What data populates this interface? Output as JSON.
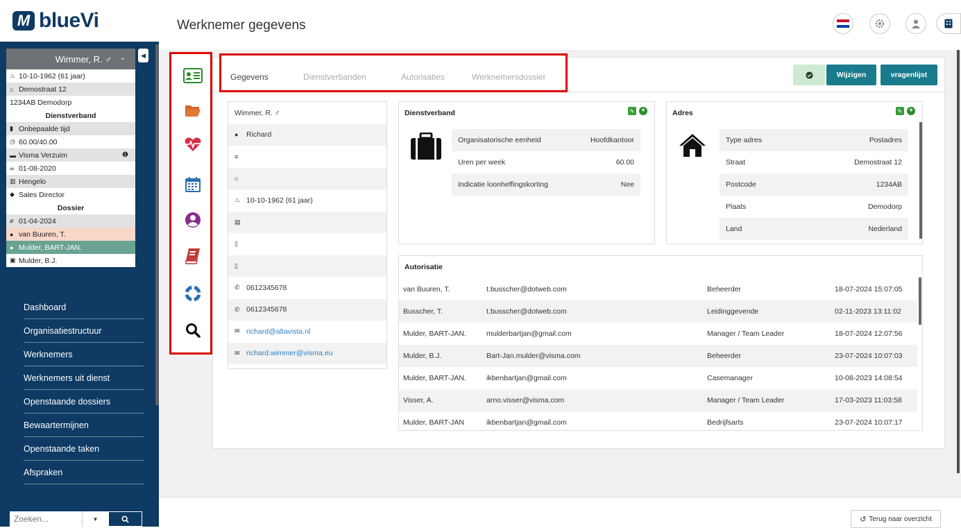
{
  "app": {
    "logo_text": "blueVi"
  },
  "employee": {
    "name": "Wimmer, R. ♂",
    "rows": [
      {
        "icon": "birthday-icon",
        "glyph": "♨",
        "text": "10-10-1962 (61 jaar)"
      },
      {
        "icon": "home-icon",
        "glyph": "⌂",
        "text": "Demostraat 12"
      },
      {
        "icon": "",
        "glyph": "",
        "text": "1234AB Demodorp"
      },
      {
        "section": true,
        "text": "Dienstverband"
      },
      {
        "icon": "briefcase-icon",
        "glyph": "▮",
        "text": "Onbepaalde tijd"
      },
      {
        "icon": "clock-icon",
        "glyph": "◷",
        "text": "60.00/40.00"
      },
      {
        "icon": "ambulance-icon",
        "glyph": "▬",
        "text": "Visma Verzuim",
        "info": true
      },
      {
        "icon": "handshake-icon",
        "glyph": "∞",
        "text": "01-08-2020"
      },
      {
        "icon": "map-icon",
        "glyph": "▥",
        "text": "Hengelo"
      },
      {
        "icon": "tag-icon",
        "glyph": "◆",
        "text": "Sales Director"
      },
      {
        "section": true,
        "text": "Dossier"
      },
      {
        "icon": "thermometer-icon",
        "glyph": "⌀",
        "text": "01-04-2024"
      },
      {
        "icon": "user-icon",
        "glyph": "●",
        "text": "van Buuren, T.",
        "style": "pk"
      },
      {
        "icon": "user-icon",
        "glyph": "●",
        "text": "Mulder, BART-JAN.",
        "style": "tl"
      },
      {
        "icon": "building-icon",
        "glyph": "▣",
        "text": "Mulder, B.J."
      }
    ]
  },
  "nav": [
    "Dashboard",
    "Organisatiestructuur",
    "Werknemers",
    "Werknemers uit dienst",
    "Openstaande dossiers",
    "Bewaartermijnen",
    "Openstaande taken",
    "Afspraken"
  ],
  "search": {
    "placeholder": "Zoeken..."
  },
  "header": {
    "title": "Werknemer gegevens"
  },
  "tabs": [
    "Gegevens",
    "Dienstverbanden",
    "Autorisaties",
    "Werknemersdossier"
  ],
  "buttons": {
    "wijzigen": "Wijzigen",
    "vragenlijst": "vragenlijst"
  },
  "colors": {
    "teal": "#1a7b8c",
    "green_btn": "#cfe9d2",
    "navy": "#0e3a63",
    "accent_red": "#d00000"
  },
  "person": [
    {
      "icon": "",
      "glyph": "",
      "text": "Wimmer, R. ♂"
    },
    {
      "icon": "user-icon",
      "glyph": "●",
      "text": "Richard"
    },
    {
      "icon": "list-icon",
      "glyph": "≡",
      "text": ""
    },
    {
      "icon": "home-icon",
      "glyph": "⌂",
      "text": ""
    },
    {
      "icon": "birthday-icon",
      "glyph": "♨",
      "text": "10-10-1962 (61 jaar)"
    },
    {
      "icon": "id-card-icon",
      "glyph": "▤",
      "text": ""
    },
    {
      "icon": "mobile-icon",
      "glyph": "▯",
      "text": ""
    },
    {
      "icon": "mobile-icon",
      "glyph": "▯",
      "text": ""
    },
    {
      "icon": "phone-icon",
      "glyph": "✆",
      "text": "0612345678"
    },
    {
      "icon": "phone-icon",
      "glyph": "✆",
      "text": "0612345678"
    },
    {
      "icon": "mail-icon",
      "glyph": "✉",
      "text": "richard@altavista.nl",
      "link": true
    },
    {
      "icon": "mail-icon",
      "glyph": "✉",
      "text": "richard.wimmer@visma.eu",
      "link": true
    }
  ],
  "dienstverband": {
    "title": "Dienstverband",
    "rows": [
      {
        "label": "Organisatorische eenheid",
        "value": "Hoofdkantoor"
      },
      {
        "label": "Uren per week",
        "value": "60.00"
      },
      {
        "label": "Indicatie loonheffingskorting",
        "value": "Nee"
      }
    ]
  },
  "adres": {
    "title": "Adres",
    "rows": [
      {
        "label": "Type adres",
        "value": "Postadres"
      },
      {
        "label": "Straat",
        "value": "Demostraat 12"
      },
      {
        "label": "Postcode",
        "value": "1234AB"
      },
      {
        "label": "Plaats",
        "value": "Demodorp"
      },
      {
        "label": "Land",
        "value": "Nederland"
      }
    ]
  },
  "autorisatie": {
    "title": "Autorisatie",
    "rows": [
      {
        "naam": "van Buuren, T.",
        "email": "t.busscher@dotweb.com",
        "rol": "Beheerder",
        "datum": "18-07-2024 15:07:05"
      },
      {
        "naam": "Busscher, T.",
        "email": "t.busscher@dotweb.com",
        "rol": "Leidinggevende",
        "datum": "02-11-2023 13:11:02"
      },
      {
        "naam": "Mulder, BART-JAN.",
        "email": "mulderbartjan@gmail.com",
        "rol": "Manager / Team Leader",
        "datum": "18-07-2024 12:07:56"
      },
      {
        "naam": "Mulder, B.J.",
        "email": "Bart-Jan.mulder@visma.com",
        "rol": "Beheerder",
        "datum": "23-07-2024 10:07:03"
      },
      {
        "naam": "Mulder, BART-JAN.",
        "email": "ikbenbartjan@gmail.com",
        "rol": "Casemanager",
        "datum": "10-08-2023 14:08:54"
      },
      {
        "naam": "Visser, A.",
        "email": "arno.visser@visma.com",
        "rol": "Manager / Team Leader",
        "datum": "17-03-2023 11:03:58"
      },
      {
        "naam": "Mulder, BART-JAN",
        "email": "ikbenbartjan@gmail.com",
        "rol": "Bedrijfsarts",
        "datum": "23-07-2024 10:07:17"
      }
    ]
  },
  "footer": {
    "back": "Terug naar overzicht"
  }
}
